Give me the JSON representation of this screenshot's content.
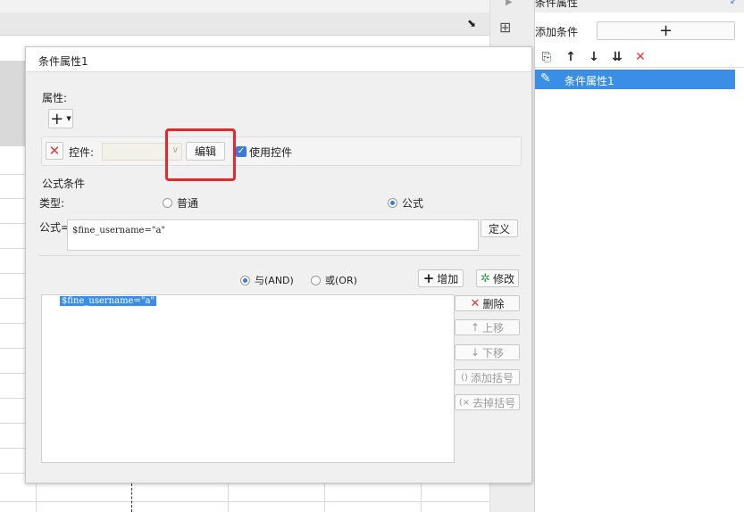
{
  "right_panel": {
    "header": "条件属性",
    "add_condition_label": "添加条件",
    "add_button": "+",
    "list": [
      {
        "label": "条件属性1",
        "selected": true
      }
    ]
  },
  "dialog": {
    "title": "条件属性1",
    "properties": {
      "section_label": "属性:",
      "add_button": "+",
      "control_label": "控件:",
      "control_value": "",
      "edit_button": "编辑",
      "use_control_label": "使用控件",
      "use_control_checked": true
    },
    "formula_condition": {
      "section_label": "公式条件",
      "type_label": "类型:",
      "type_normal": "普通",
      "type_formula": "公式",
      "selected_type": "公式",
      "formula_label": "公式=",
      "formula_value": "$fine_username=\"a\"",
      "define_button": "定义",
      "and_label": "与(AND)",
      "or_label": "或(OR)",
      "logic_selected": "与(AND)",
      "add_button": "增加",
      "modify_button": "修改",
      "conditions": [
        "$fine_username=\"a\""
      ],
      "delete_button": "删除",
      "move_up_button": "上移",
      "move_down_button": "下移",
      "add_bracket_button": "添加括号",
      "remove_bracket_button": "去掉括号"
    }
  },
  "colors": {
    "selection": "#3a8ee6",
    "highlight_box": "#e8262b",
    "delete_red": "#e53935",
    "modify_green": "#2e9b4e"
  }
}
